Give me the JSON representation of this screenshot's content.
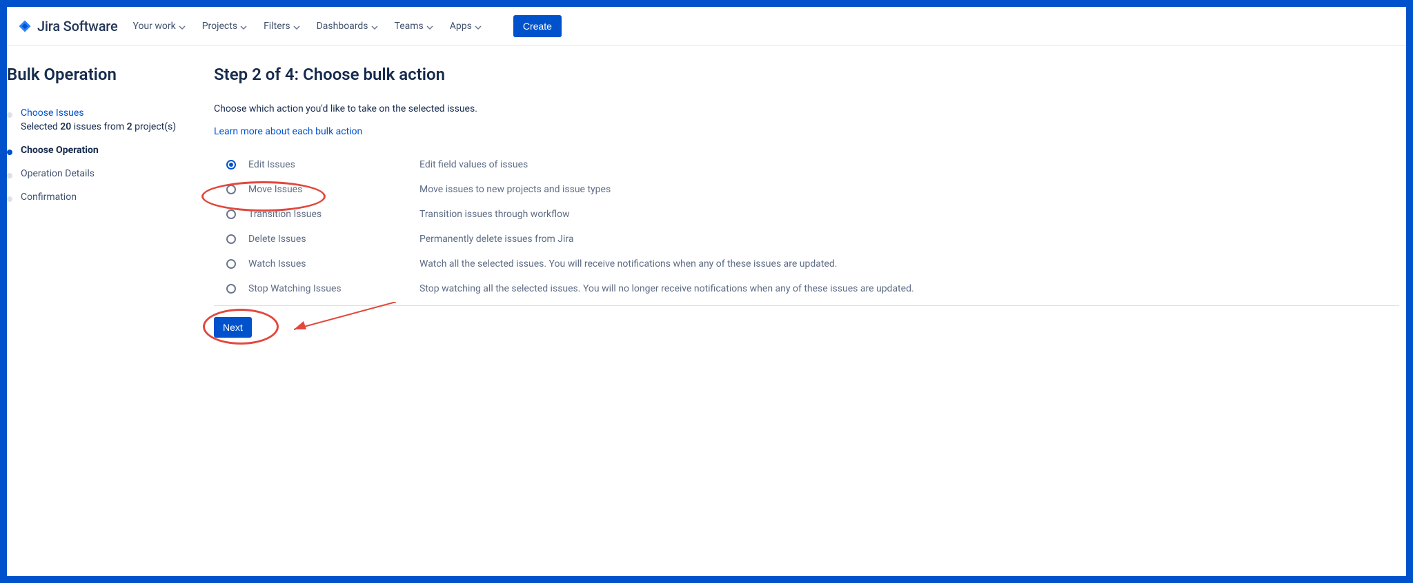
{
  "brand": {
    "product": "Jira Software"
  },
  "nav": {
    "your_work": "Your work",
    "projects": "Projects",
    "filters": "Filters",
    "dashboards": "Dashboards",
    "teams": "Teams",
    "apps": "Apps",
    "create": "Create"
  },
  "sidebar": {
    "title": "Bulk Operation",
    "steps": {
      "choose_issues": {
        "label": "Choose Issues",
        "sub_prefix": "Selected ",
        "count": "20",
        "sub_mid": " issues from ",
        "project_count": "2",
        "sub_suffix": " project(s)"
      },
      "choose_operation": {
        "label": "Choose Operation"
      },
      "operation_details": {
        "label": "Operation Details"
      },
      "confirmation": {
        "label": "Confirmation"
      }
    }
  },
  "main": {
    "heading": "Step 2 of 4: Choose bulk action",
    "intro": "Choose which action you'd like to take on the selected issues.",
    "learn_link": "Learn more about each bulk action",
    "actions": {
      "edit": {
        "label": "Edit Issues",
        "desc": "Edit field values of issues"
      },
      "move": {
        "label": "Move Issues",
        "desc": "Move issues to new projects and issue types"
      },
      "transition": {
        "label": "Transition Issues",
        "desc": "Transition issues through workflow"
      },
      "delete": {
        "label": "Delete Issues",
        "desc": "Permanently delete issues from Jira"
      },
      "watch": {
        "label": "Watch Issues",
        "desc": "Watch all the selected issues. You will receive notifications when any of these issues are updated."
      },
      "stop": {
        "label": "Stop Watching Issues",
        "desc": "Stop watching all the selected issues. You will no longer receive notifications when any of these issues are updated."
      }
    },
    "next_button": "Next"
  }
}
